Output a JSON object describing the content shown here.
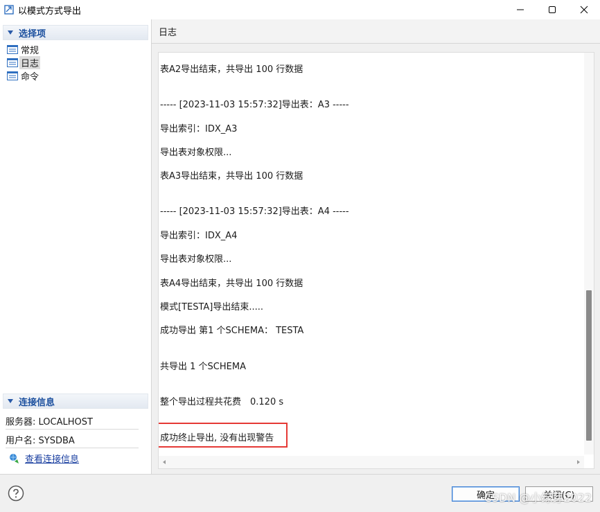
{
  "window": {
    "title": "以模式方式导出"
  },
  "sidebar": {
    "section_title": "选择项",
    "items": [
      {
        "label": "常规",
        "selected": false
      },
      {
        "label": "日志",
        "selected": true
      },
      {
        "label": "命令",
        "selected": false
      }
    ],
    "connection": {
      "section_title": "连接信息",
      "server": "服务器: LOCALHOST",
      "user": "用户名: SYSDBA",
      "link": "查看连接信息"
    }
  },
  "panel": {
    "title": "日志",
    "log_lines": [
      "表A2导出结束，共导出 100 行数据",
      "----- [2023-11-03 15:57:32]导出表：A3 -----",
      "导出索引：IDX_A3",
      "导出表对象权限...",
      "表A3导出结束，共导出 100 行数据",
      "----- [2023-11-03 15:57:32]导出表：A4 -----",
      "导出索引：IDX_A4",
      "导出表对象权限...",
      "表A4导出结束，共导出 100 行数据",
      "模式[TESTA]导出结束.....",
      "成功导出 第1 个SCHEMA： TESTA",
      "共导出 1 个SCHEMA",
      "整个导出过程共花费　0.120 s",
      "成功终止导出, 没有出现警告"
    ]
  },
  "buttons": {
    "ok": "确定",
    "close": "关闭(C)"
  },
  "watermark": "CSDN @小绿芽2022",
  "colors": {
    "accent": "#1b4f9e",
    "highlight": "#e53935",
    "link": "#1a3fa0"
  }
}
